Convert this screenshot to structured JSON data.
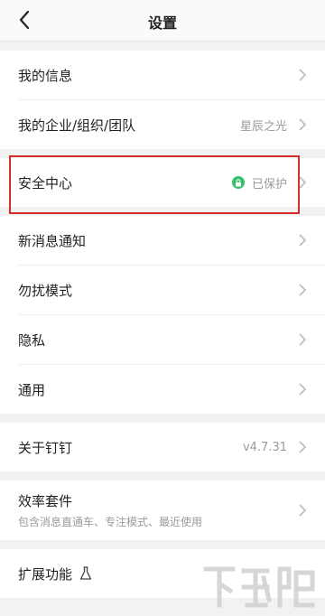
{
  "header": {
    "title": "设置",
    "back_icon": "chevron-left-icon"
  },
  "settings": [
    {
      "group": [
        {
          "label": "我的信息",
          "value": ""
        },
        {
          "label": "我的企业/组织/团队",
          "value": "星辰之光"
        }
      ]
    },
    {
      "group": [
        {
          "label": "安全中心",
          "value": "已保护",
          "status_color": "#33c26a"
        }
      ]
    },
    {
      "group": [
        {
          "label": "新消息通知",
          "value": ""
        },
        {
          "label": "勿扰模式",
          "value": ""
        },
        {
          "label": "隐私",
          "value": ""
        },
        {
          "label": "通用",
          "value": ""
        }
      ]
    },
    {
      "group": [
        {
          "label": "关于钉钉",
          "value": "v4.7.31"
        }
      ]
    },
    {
      "group": [
        {
          "label": "效率套件",
          "subtitle": "包含消息直通车、专注模式、最近使用"
        }
      ]
    },
    {
      "group": [
        {
          "label": "扩展功能",
          "icon": "flask-icon"
        }
      ]
    }
  ],
  "watermark": {
    "text": "下载吧"
  },
  "colors": {
    "highlight_border": "#d42e2e",
    "accent_green": "#33c26a"
  }
}
